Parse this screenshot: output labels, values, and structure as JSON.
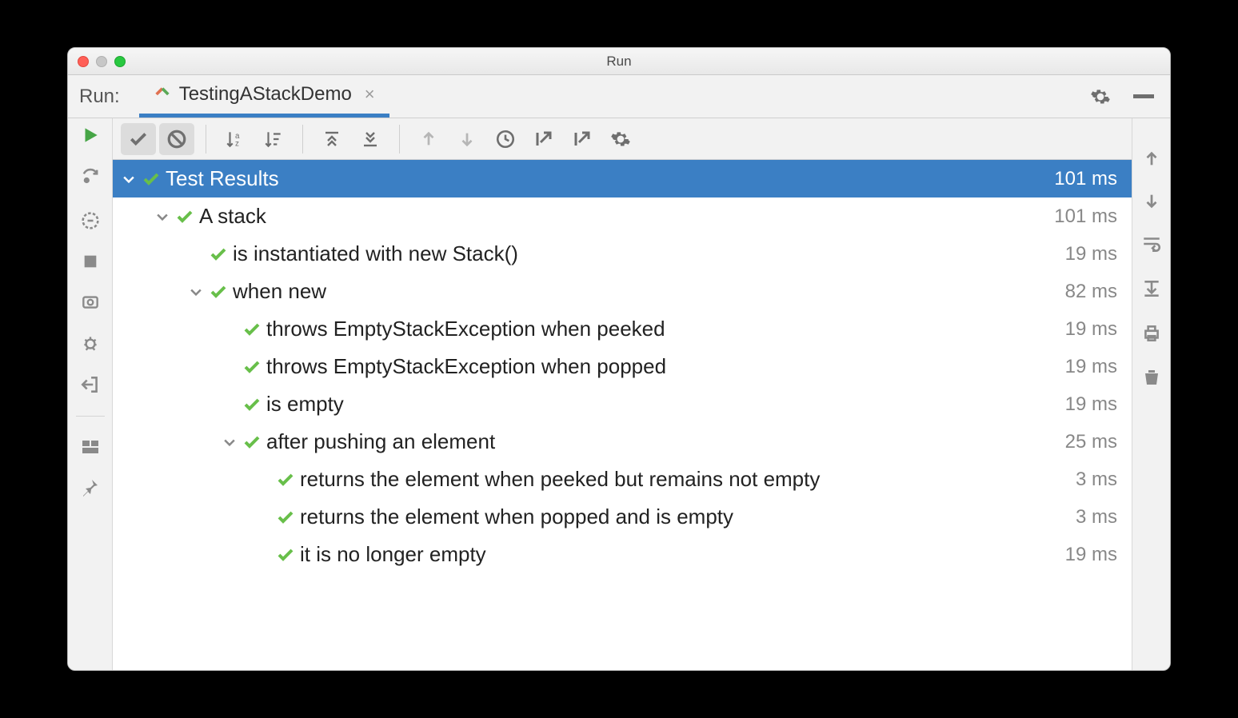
{
  "window": {
    "title": "Run"
  },
  "tab": {
    "run_label": "Run:",
    "name": "TestingAStackDemo"
  },
  "tree": {
    "root": {
      "label": "Test Results",
      "time": "101 ms"
    },
    "nodes": [
      {
        "depth": 1,
        "chev": true,
        "label": "A stack",
        "time": "101 ms"
      },
      {
        "depth": 2,
        "chev": false,
        "label": "is instantiated with new Stack()",
        "time": "19 ms"
      },
      {
        "depth": 2,
        "chev": true,
        "label": "when new",
        "time": "82 ms"
      },
      {
        "depth": 3,
        "chev": false,
        "label": "throws EmptyStackException when peeked",
        "time": "19 ms"
      },
      {
        "depth": 3,
        "chev": false,
        "label": "throws EmptyStackException when popped",
        "time": "19 ms"
      },
      {
        "depth": 3,
        "chev": false,
        "label": "is empty",
        "time": "19 ms"
      },
      {
        "depth": 3,
        "chev": true,
        "label": "after pushing an element",
        "time": "25 ms"
      },
      {
        "depth": 4,
        "chev": false,
        "label": "returns the element when peeked but remains not empty",
        "time": "3 ms"
      },
      {
        "depth": 4,
        "chev": false,
        "label": "returns the element when popped and is empty",
        "time": "3 ms"
      },
      {
        "depth": 4,
        "chev": false,
        "label": "it is no longer empty",
        "time": "19 ms"
      }
    ]
  }
}
